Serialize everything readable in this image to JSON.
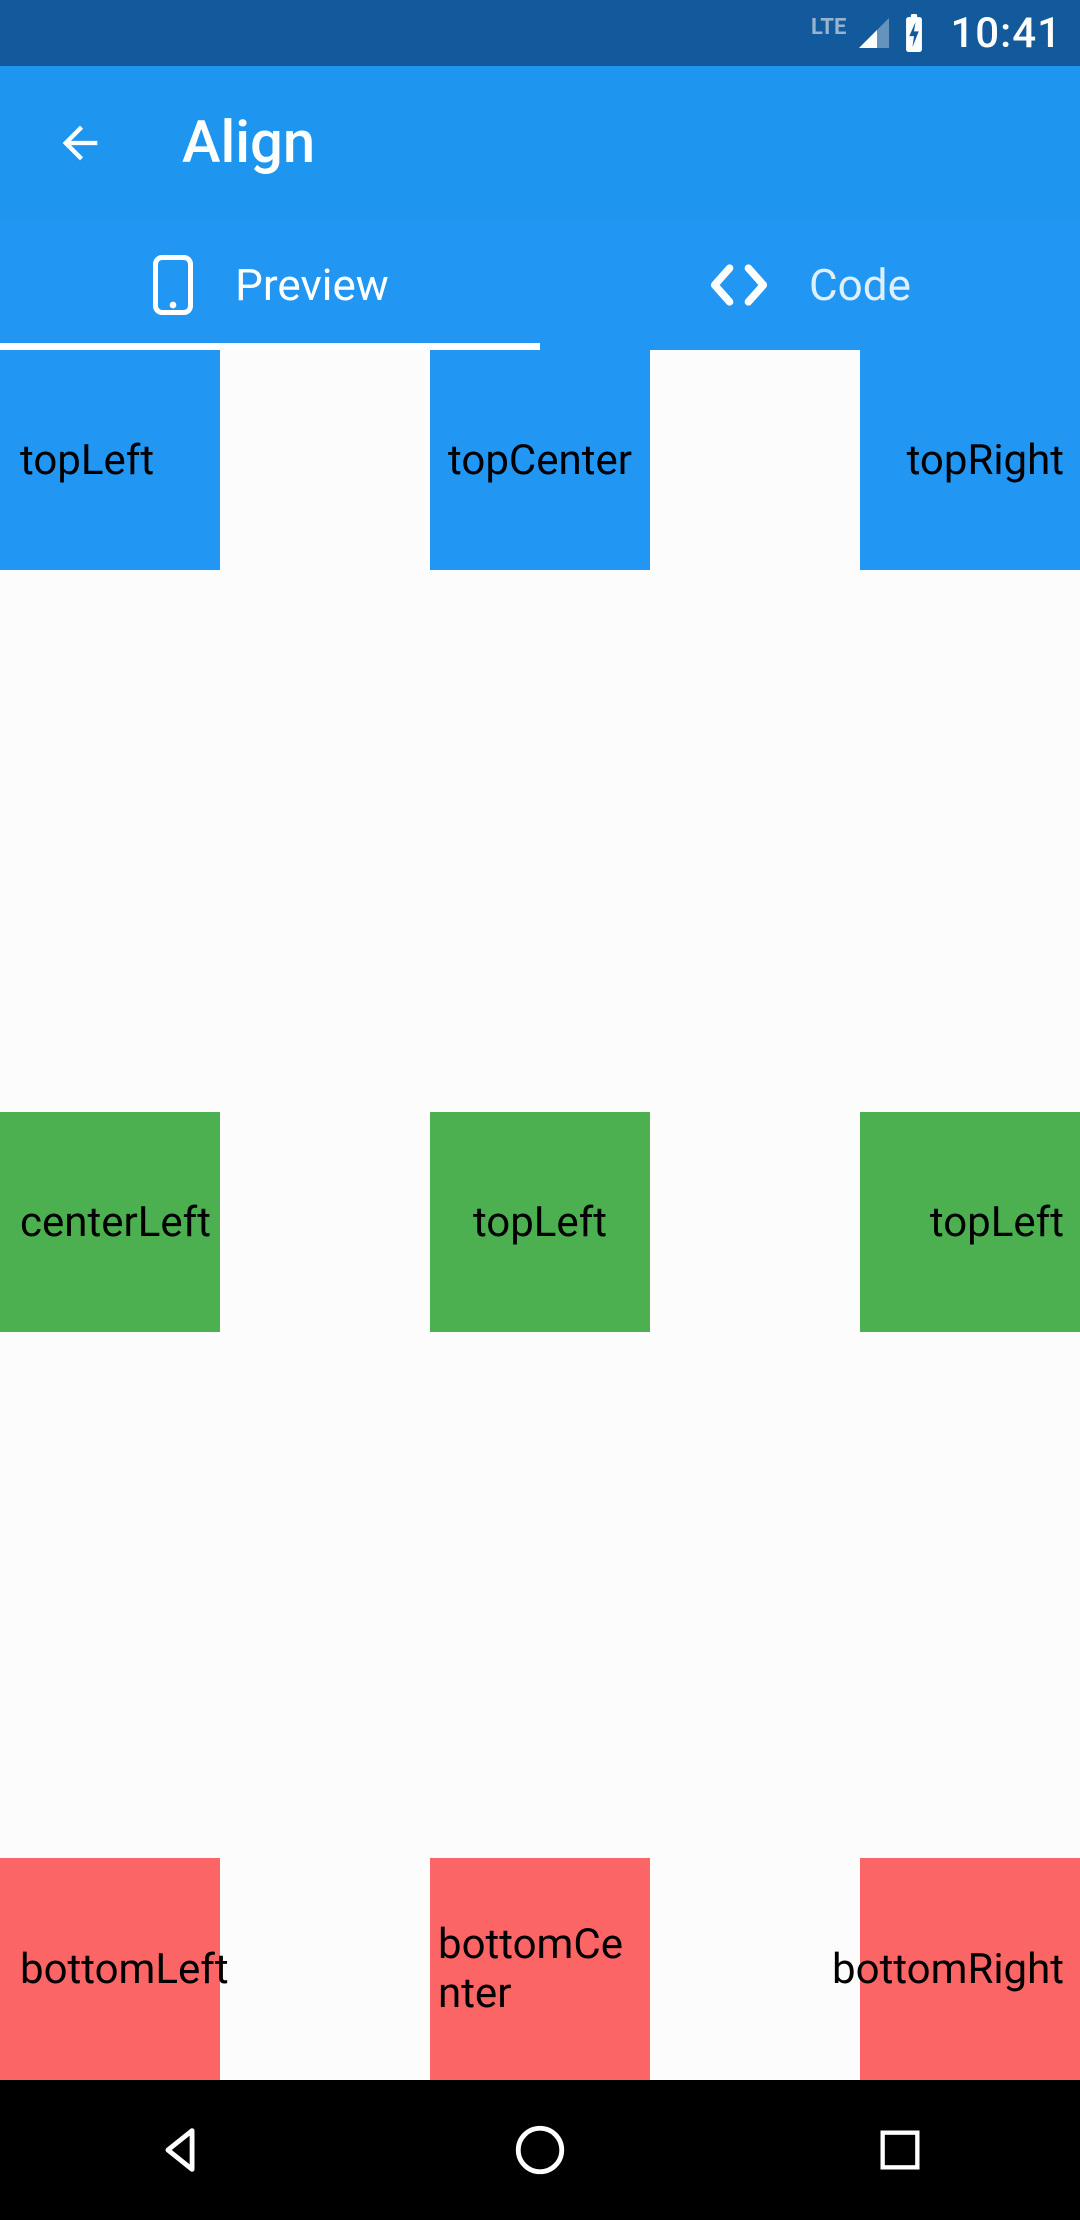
{
  "status_bar": {
    "network_label": "LTE",
    "clock": "10:41"
  },
  "app_bar": {
    "title": "Align"
  },
  "tabs": {
    "preview_label": "Preview",
    "code_label": "Code",
    "active": "preview"
  },
  "tiles": {
    "top": {
      "left": "topLeft",
      "center": "topCenter",
      "right": "topRight"
    },
    "middle": {
      "left": "centerLeft",
      "center": "topLeft",
      "right": "topLeft"
    },
    "bottom": {
      "left": "bottomLeft",
      "center": "bottomCenter",
      "right": "bottomRight"
    }
  },
  "colors": {
    "top_row": "#2196f3",
    "middle_row": "#4caf50",
    "bottom_row": "#fb6565"
  }
}
